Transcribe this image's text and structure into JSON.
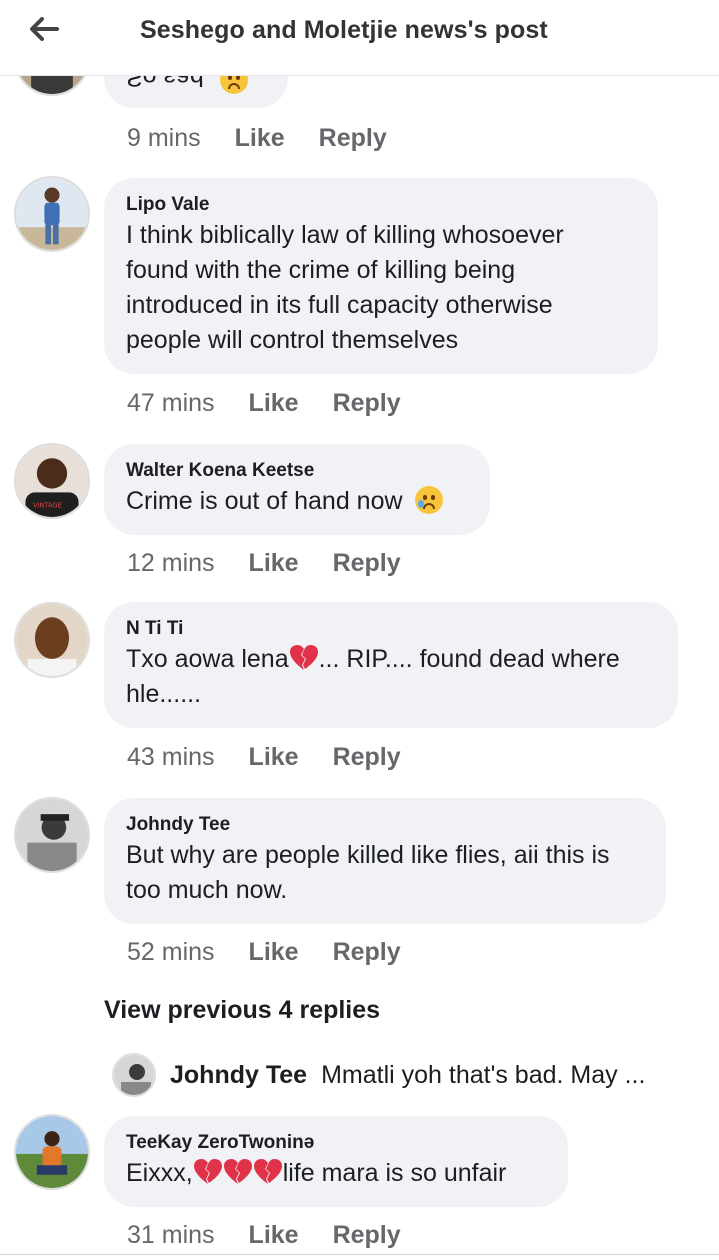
{
  "header": {
    "back_icon": "arrow-left-icon",
    "title": "Seshego and Moletjie news's post"
  },
  "partial_comment": {
    "text": "So sad",
    "emoji": "sad-face-emoji"
  },
  "comments": [
    {
      "meta_time": "9 mins",
      "like": "Like",
      "reply": "Reply"
    },
    {
      "author": "Lipo Vale",
      "lines": [
        "I think  biblically  law of killing  whosoever",
        "found  with  the  crime  of killing  being",
        "introduced  in its full capacity  otherwise",
        "people  will control themselves"
      ],
      "time": "47 mins",
      "like": "Like",
      "reply": "Reply"
    },
    {
      "author": "Walter Koena Keetse",
      "text": "Crime is out of hand now",
      "emoji": "crying-face-emoji",
      "time": "12 mins",
      "like": "Like",
      "reply": "Reply"
    },
    {
      "author": "N Ti Ti",
      "text_a": "Txo aowa lena",
      "text_b": "... RIP.... found dead where",
      "line2": "hle......",
      "emoji": "broken-heart-emoji",
      "time": "43 mins",
      "like": "Like",
      "reply": "Reply"
    },
    {
      "author": "Johndy Tee",
      "lines": [
        "But why are people killed like flies, aii this is",
        "too much now."
      ],
      "time": "52 mins",
      "like": "Like",
      "reply": "Reply"
    }
  ],
  "view_previous": "View previous 4 replies",
  "nested_reply": {
    "author": "Johndy Tee",
    "text": "Mmatli yoh that's bad. May ..."
  },
  "last_comment": {
    "author": "TeeKay ZeroTwoninə",
    "text_a": "Eixxx,",
    "text_b": "life mara is so unfair",
    "emoji": "broken-heart-emoji",
    "time": "31 mins",
    "like": "Like",
    "reply": "Reply"
  }
}
